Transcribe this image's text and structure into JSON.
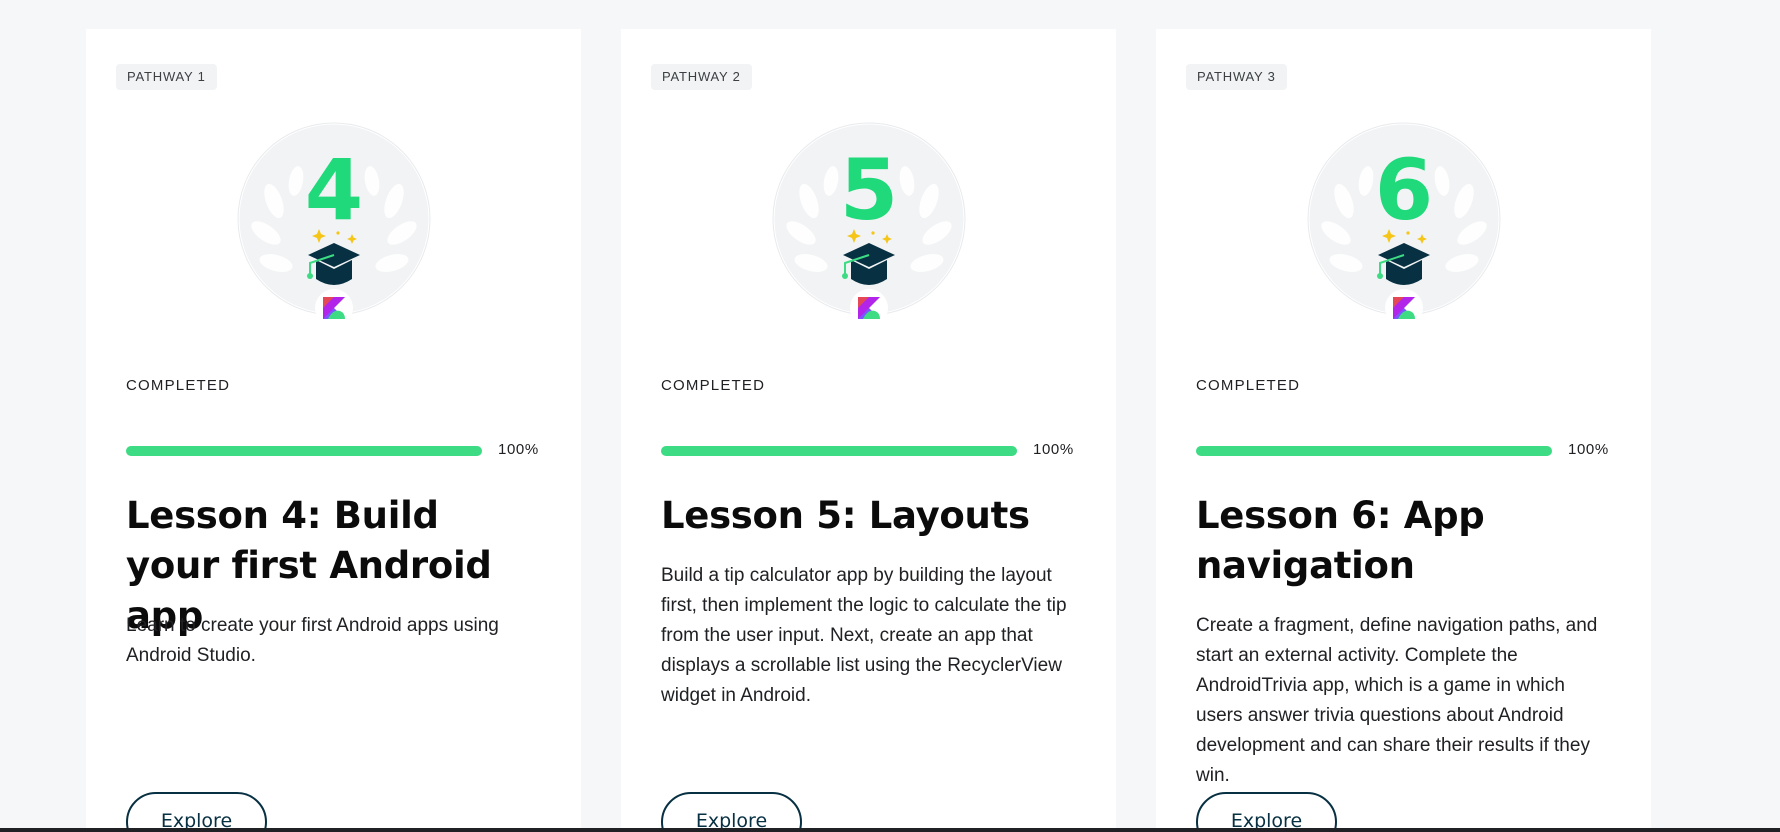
{
  "colors": {
    "accent_green": "#3ddc84",
    "number_green": "#1fd97a",
    "dark_navy": "#073042",
    "page_bg": "#f6f7f9"
  },
  "cards": [
    {
      "pathway": "PATHWAY 1",
      "badge_number": "4",
      "status": "COMPLETED",
      "progress": 1.0,
      "progress_label": "100%",
      "title": "Lesson 4: Build your first Android app",
      "description": "Learn to create your first Android apps using Android Studio.",
      "button": "Explore"
    },
    {
      "pathway": "PATHWAY 2",
      "badge_number": "5",
      "status": "COMPLETED",
      "progress": 1.0,
      "progress_label": "100%",
      "title": "Lesson 5: Layouts",
      "description": "Build a tip calculator app by building the layout first, then implement the logic to calculate the tip from the user input. Next, create an app that displays a scrollable list using the RecyclerView widget in Android.",
      "button": "Explore"
    },
    {
      "pathway": "PATHWAY 3",
      "badge_number": "6",
      "status": "COMPLETED",
      "progress": 1.0,
      "progress_label": "100%",
      "title": "Lesson 6: App navigation",
      "description": "Create a fragment, define navigation paths, and start an external activity. Complete the AndroidTrivia app, which is a game in which users answer trivia questions about Android development and can share their results if they win.",
      "button": "Explore"
    }
  ],
  "icons": [
    "laurel-wreath-icon",
    "graduation-cap-icon",
    "sparkle-icon",
    "kotlin-logo-icon"
  ]
}
